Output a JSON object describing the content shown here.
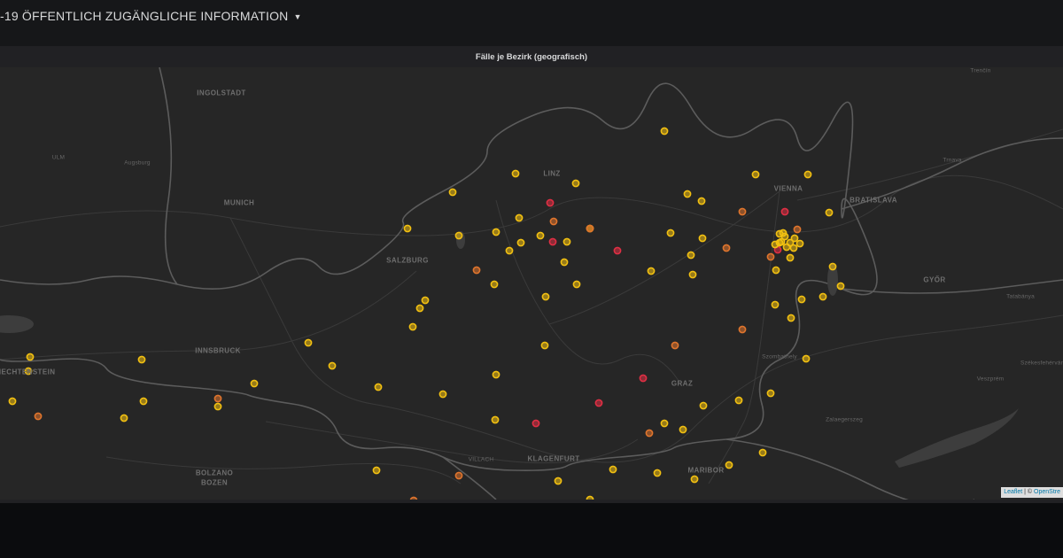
{
  "dashboard": {
    "title": "-19 ÖFFENTLICH ZUGÄNGLICHE INFORMATION"
  },
  "panel": {
    "title": "Fälle je Bezirk (geografisch)"
  },
  "map": {
    "attribution": {
      "leaflet": "Leaflet",
      "separator": " | © ",
      "osm": "OpenStre"
    },
    "colors": {
      "yellow": "#f2c011",
      "orange": "#e0752d",
      "red": "#e02f44",
      "land": "#262626",
      "border": "#5a5a5a"
    },
    "cities": [
      {
        "name": "INGOLSTADT",
        "size": "big"
      },
      {
        "name": "ULM",
        "size": "small"
      },
      {
        "name": "Augsburg",
        "size": "small"
      },
      {
        "name": "MUNICH",
        "size": "big"
      },
      {
        "name": "SALZBURG",
        "size": "big"
      },
      {
        "name": "LINZ",
        "size": "big"
      },
      {
        "name": "VIENNA",
        "size": "big"
      },
      {
        "name": "BRATISLAVA",
        "size": "big"
      },
      {
        "name": "Trnava",
        "size": "small"
      },
      {
        "name": "Trenčín",
        "size": "small"
      },
      {
        "name": "GYŐR",
        "size": "big"
      },
      {
        "name": "Tatabánya",
        "size": "small"
      },
      {
        "name": "Székesfehérvár",
        "size": "small"
      },
      {
        "name": "Veszprém",
        "size": "small"
      },
      {
        "name": "Szombathely",
        "size": "small"
      },
      {
        "name": "Zalaegerszeg",
        "size": "small"
      },
      {
        "name": "INNSBRUCK",
        "size": "big"
      },
      {
        "name": "GRAZ",
        "size": "big"
      },
      {
        "name": "KLAGENFURT",
        "size": "big"
      },
      {
        "name": "VILLACH",
        "size": "small"
      },
      {
        "name": "MARIBOR",
        "size": "big"
      },
      {
        "name": "BOLZANO",
        "size": "big"
      },
      {
        "name": "BOZEN",
        "size": "big"
      },
      {
        "name": "LIECHTENSTEIN",
        "size": "big"
      }
    ],
    "markers": [
      {
        "level": "yellow"
      },
      {
        "level": "yellow"
      },
      {
        "level": "yellow"
      },
      {
        "level": "red"
      },
      {
        "level": "yellow"
      },
      {
        "level": "yellow"
      },
      {
        "level": "yellow"
      },
      {
        "level": "yellow"
      },
      {
        "level": "orange"
      },
      {
        "level": "yellow"
      },
      {
        "level": "yellow"
      },
      {
        "level": "orange"
      },
      {
        "level": "red"
      },
      {
        "level": "yellow"
      },
      {
        "level": "yellow"
      },
      {
        "level": "yellow"
      },
      {
        "level": "yellow"
      },
      {
        "level": "yellow"
      },
      {
        "level": "yellow"
      },
      {
        "level": "yellow"
      },
      {
        "level": "yellow"
      },
      {
        "level": "orange"
      },
      {
        "level": "yellow"
      },
      {
        "level": "yellow"
      },
      {
        "level": "orange"
      },
      {
        "level": "red"
      },
      {
        "level": "yellow"
      },
      {
        "level": "yellow"
      },
      {
        "level": "yellow"
      },
      {
        "level": "yellow"
      },
      {
        "level": "yellow"
      },
      {
        "level": "orange"
      },
      {
        "level": "yellow"
      },
      {
        "level": "yellow"
      },
      {
        "level": "yellow"
      },
      {
        "level": "yellow"
      },
      {
        "level": "yellow"
      },
      {
        "level": "yellow"
      },
      {
        "level": "yellow"
      },
      {
        "level": "yellow"
      },
      {
        "level": "yellow"
      },
      {
        "level": "yellow"
      },
      {
        "level": "yellow"
      },
      {
        "level": "orange"
      },
      {
        "level": "yellow"
      },
      {
        "level": "yellow"
      },
      {
        "level": "yellow"
      },
      {
        "level": "yellow"
      },
      {
        "level": "orange"
      },
      {
        "level": "orange"
      },
      {
        "level": "orange"
      },
      {
        "level": "red"
      },
      {
        "level": "yellow"
      },
      {
        "level": "yellow"
      },
      {
        "level": "yellow"
      },
      {
        "level": "yellow"
      },
      {
        "level": "yellow"
      },
      {
        "level": "yellow"
      },
      {
        "level": "yellow"
      },
      {
        "level": "yellow"
      },
      {
        "level": "yellow"
      },
      {
        "level": "yellow"
      },
      {
        "level": "yellow"
      },
      {
        "level": "yellow"
      },
      {
        "level": "yellow"
      },
      {
        "level": "orange"
      },
      {
        "level": "yellow"
      },
      {
        "level": "red"
      },
      {
        "level": "red"
      },
      {
        "level": "red"
      },
      {
        "level": "yellow"
      },
      {
        "level": "yellow"
      },
      {
        "level": "orange"
      },
      {
        "level": "orange"
      },
      {
        "level": "yellow"
      },
      {
        "level": "yellow"
      },
      {
        "level": "yellow"
      },
      {
        "level": "yellow"
      },
      {
        "level": "yellow"
      },
      {
        "level": "yellow"
      },
      {
        "level": "yellow"
      },
      {
        "level": "yellow"
      },
      {
        "level": "yellow"
      },
      {
        "level": "yellow"
      },
      {
        "level": "yellow"
      },
      {
        "level": "yellow"
      },
      {
        "level": "yellow"
      },
      {
        "level": "yellow"
      },
      {
        "level": "yellow"
      },
      {
        "level": "yellow"
      },
      {
        "level": "yellow"
      },
      {
        "level": "red"
      },
      {
        "level": "orange"
      },
      {
        "level": "yellow"
      },
      {
        "level": "orange"
      },
      {
        "level": "yellow"
      },
      {
        "level": "yellow"
      },
      {
        "level": "yellow"
      },
      {
        "level": "yellow"
      },
      {
        "level": "yellow"
      },
      {
        "level": "yellow"
      },
      {
        "level": "yellow"
      },
      {
        "level": "yellow"
      },
      {
        "level": "yellow"
      }
    ]
  }
}
